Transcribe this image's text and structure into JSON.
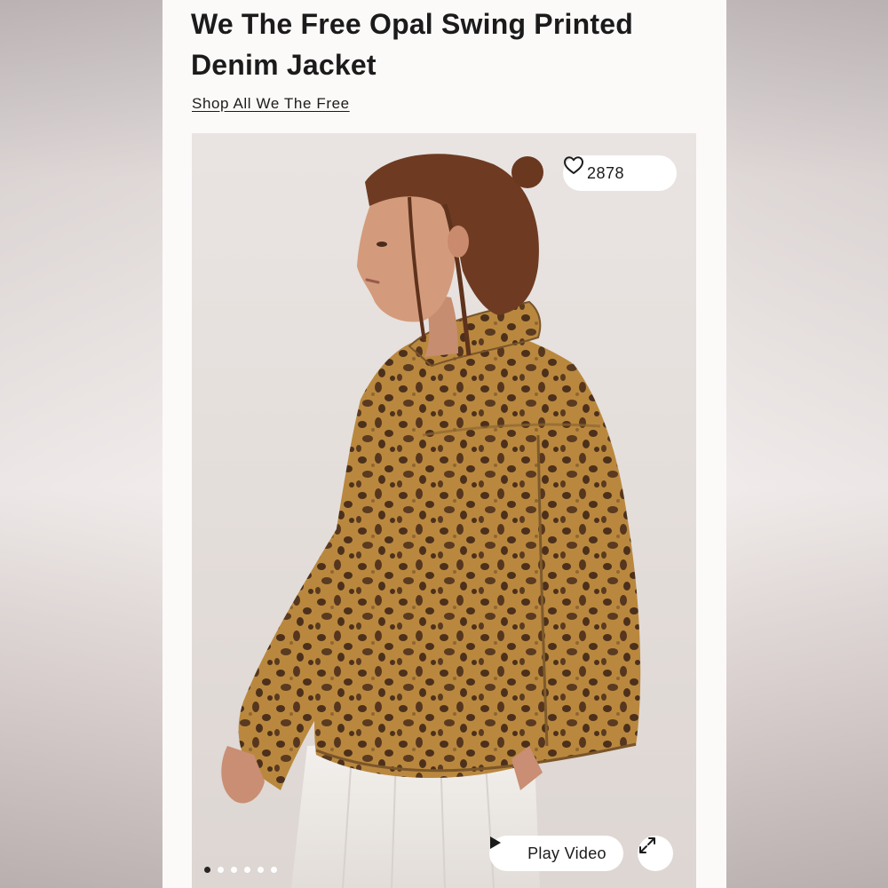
{
  "product": {
    "title": "We The Free Opal Swing Printed Denim Jacket",
    "shop_link": "Shop All We The Free"
  },
  "gallery": {
    "likes_count": "2878",
    "likes_icon": "heart-icon",
    "play_label": "Play Video",
    "play_icon": "play-icon",
    "expand_icon": "expand-icon",
    "dot_count": 6,
    "active_dot": 1
  },
  "colors": {
    "text": "#1c1b1b",
    "panel": "#fcfaf9",
    "photo_bg": "#e6e0dd",
    "jacket": "#b8893f",
    "spots": "#4a2f1a",
    "hair": "#6b3a22"
  }
}
